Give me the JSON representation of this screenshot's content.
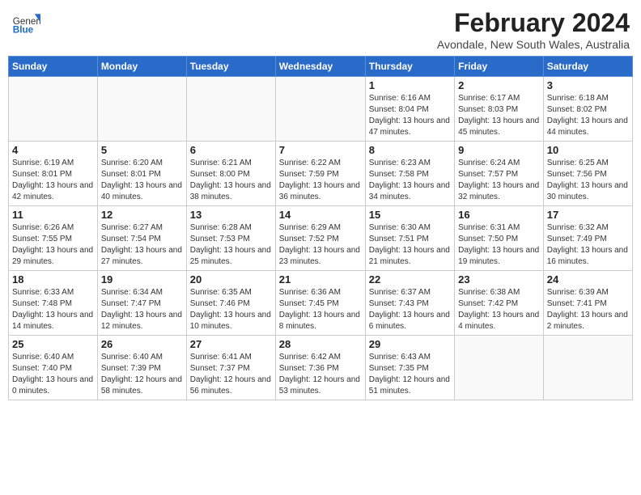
{
  "header": {
    "logo_general": "General",
    "logo_blue": "Blue",
    "title": "February 2024",
    "subtitle": "Avondale, New South Wales, Australia"
  },
  "days_of_week": [
    "Sunday",
    "Monday",
    "Tuesday",
    "Wednesday",
    "Thursday",
    "Friday",
    "Saturday"
  ],
  "weeks": [
    [
      {
        "day": "",
        "info": ""
      },
      {
        "day": "",
        "info": ""
      },
      {
        "day": "",
        "info": ""
      },
      {
        "day": "",
        "info": ""
      },
      {
        "day": "1",
        "info": "Sunrise: 6:16 AM\nSunset: 8:04 PM\nDaylight: 13 hours and 47 minutes."
      },
      {
        "day": "2",
        "info": "Sunrise: 6:17 AM\nSunset: 8:03 PM\nDaylight: 13 hours and 45 minutes."
      },
      {
        "day": "3",
        "info": "Sunrise: 6:18 AM\nSunset: 8:02 PM\nDaylight: 13 hours and 44 minutes."
      }
    ],
    [
      {
        "day": "4",
        "info": "Sunrise: 6:19 AM\nSunset: 8:01 PM\nDaylight: 13 hours and 42 minutes."
      },
      {
        "day": "5",
        "info": "Sunrise: 6:20 AM\nSunset: 8:01 PM\nDaylight: 13 hours and 40 minutes."
      },
      {
        "day": "6",
        "info": "Sunrise: 6:21 AM\nSunset: 8:00 PM\nDaylight: 13 hours and 38 minutes."
      },
      {
        "day": "7",
        "info": "Sunrise: 6:22 AM\nSunset: 7:59 PM\nDaylight: 13 hours and 36 minutes."
      },
      {
        "day": "8",
        "info": "Sunrise: 6:23 AM\nSunset: 7:58 PM\nDaylight: 13 hours and 34 minutes."
      },
      {
        "day": "9",
        "info": "Sunrise: 6:24 AM\nSunset: 7:57 PM\nDaylight: 13 hours and 32 minutes."
      },
      {
        "day": "10",
        "info": "Sunrise: 6:25 AM\nSunset: 7:56 PM\nDaylight: 13 hours and 30 minutes."
      }
    ],
    [
      {
        "day": "11",
        "info": "Sunrise: 6:26 AM\nSunset: 7:55 PM\nDaylight: 13 hours and 29 minutes."
      },
      {
        "day": "12",
        "info": "Sunrise: 6:27 AM\nSunset: 7:54 PM\nDaylight: 13 hours and 27 minutes."
      },
      {
        "day": "13",
        "info": "Sunrise: 6:28 AM\nSunset: 7:53 PM\nDaylight: 13 hours and 25 minutes."
      },
      {
        "day": "14",
        "info": "Sunrise: 6:29 AM\nSunset: 7:52 PM\nDaylight: 13 hours and 23 minutes."
      },
      {
        "day": "15",
        "info": "Sunrise: 6:30 AM\nSunset: 7:51 PM\nDaylight: 13 hours and 21 minutes."
      },
      {
        "day": "16",
        "info": "Sunrise: 6:31 AM\nSunset: 7:50 PM\nDaylight: 13 hours and 19 minutes."
      },
      {
        "day": "17",
        "info": "Sunrise: 6:32 AM\nSunset: 7:49 PM\nDaylight: 13 hours and 16 minutes."
      }
    ],
    [
      {
        "day": "18",
        "info": "Sunrise: 6:33 AM\nSunset: 7:48 PM\nDaylight: 13 hours and 14 minutes."
      },
      {
        "day": "19",
        "info": "Sunrise: 6:34 AM\nSunset: 7:47 PM\nDaylight: 13 hours and 12 minutes."
      },
      {
        "day": "20",
        "info": "Sunrise: 6:35 AM\nSunset: 7:46 PM\nDaylight: 13 hours and 10 minutes."
      },
      {
        "day": "21",
        "info": "Sunrise: 6:36 AM\nSunset: 7:45 PM\nDaylight: 13 hours and 8 minutes."
      },
      {
        "day": "22",
        "info": "Sunrise: 6:37 AM\nSunset: 7:43 PM\nDaylight: 13 hours and 6 minutes."
      },
      {
        "day": "23",
        "info": "Sunrise: 6:38 AM\nSunset: 7:42 PM\nDaylight: 13 hours and 4 minutes."
      },
      {
        "day": "24",
        "info": "Sunrise: 6:39 AM\nSunset: 7:41 PM\nDaylight: 13 hours and 2 minutes."
      }
    ],
    [
      {
        "day": "25",
        "info": "Sunrise: 6:40 AM\nSunset: 7:40 PM\nDaylight: 13 hours and 0 minutes."
      },
      {
        "day": "26",
        "info": "Sunrise: 6:40 AM\nSunset: 7:39 PM\nDaylight: 12 hours and 58 minutes."
      },
      {
        "day": "27",
        "info": "Sunrise: 6:41 AM\nSunset: 7:37 PM\nDaylight: 12 hours and 56 minutes."
      },
      {
        "day": "28",
        "info": "Sunrise: 6:42 AM\nSunset: 7:36 PM\nDaylight: 12 hours and 53 minutes."
      },
      {
        "day": "29",
        "info": "Sunrise: 6:43 AM\nSunset: 7:35 PM\nDaylight: 12 hours and 51 minutes."
      },
      {
        "day": "",
        "info": ""
      },
      {
        "day": "",
        "info": ""
      }
    ]
  ]
}
